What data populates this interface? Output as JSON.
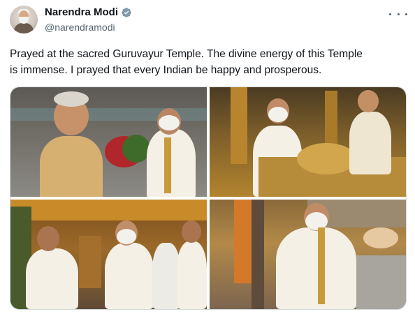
{
  "author": {
    "display_name": "Narendra Modi",
    "handle": "@narendramodi",
    "verified": true
  },
  "tweet": {
    "text": "Prayed at the sacred Guruvayur Temple. The divine energy of this Temple\nis immense. I prayed that every Indian be happy and prosperous."
  },
  "media": {
    "photos": [
      {
        "position": "top-left"
      },
      {
        "position": "top-right"
      },
      {
        "position": "bottom-left"
      },
      {
        "position": "bottom-right"
      }
    ]
  },
  "icons": {
    "verified": "verified-badge-icon",
    "more": "more-options-icon"
  },
  "colors": {
    "verified_blue": "#1d9bf0",
    "secondary_text": "#536471",
    "border": "#cfd9de"
  }
}
